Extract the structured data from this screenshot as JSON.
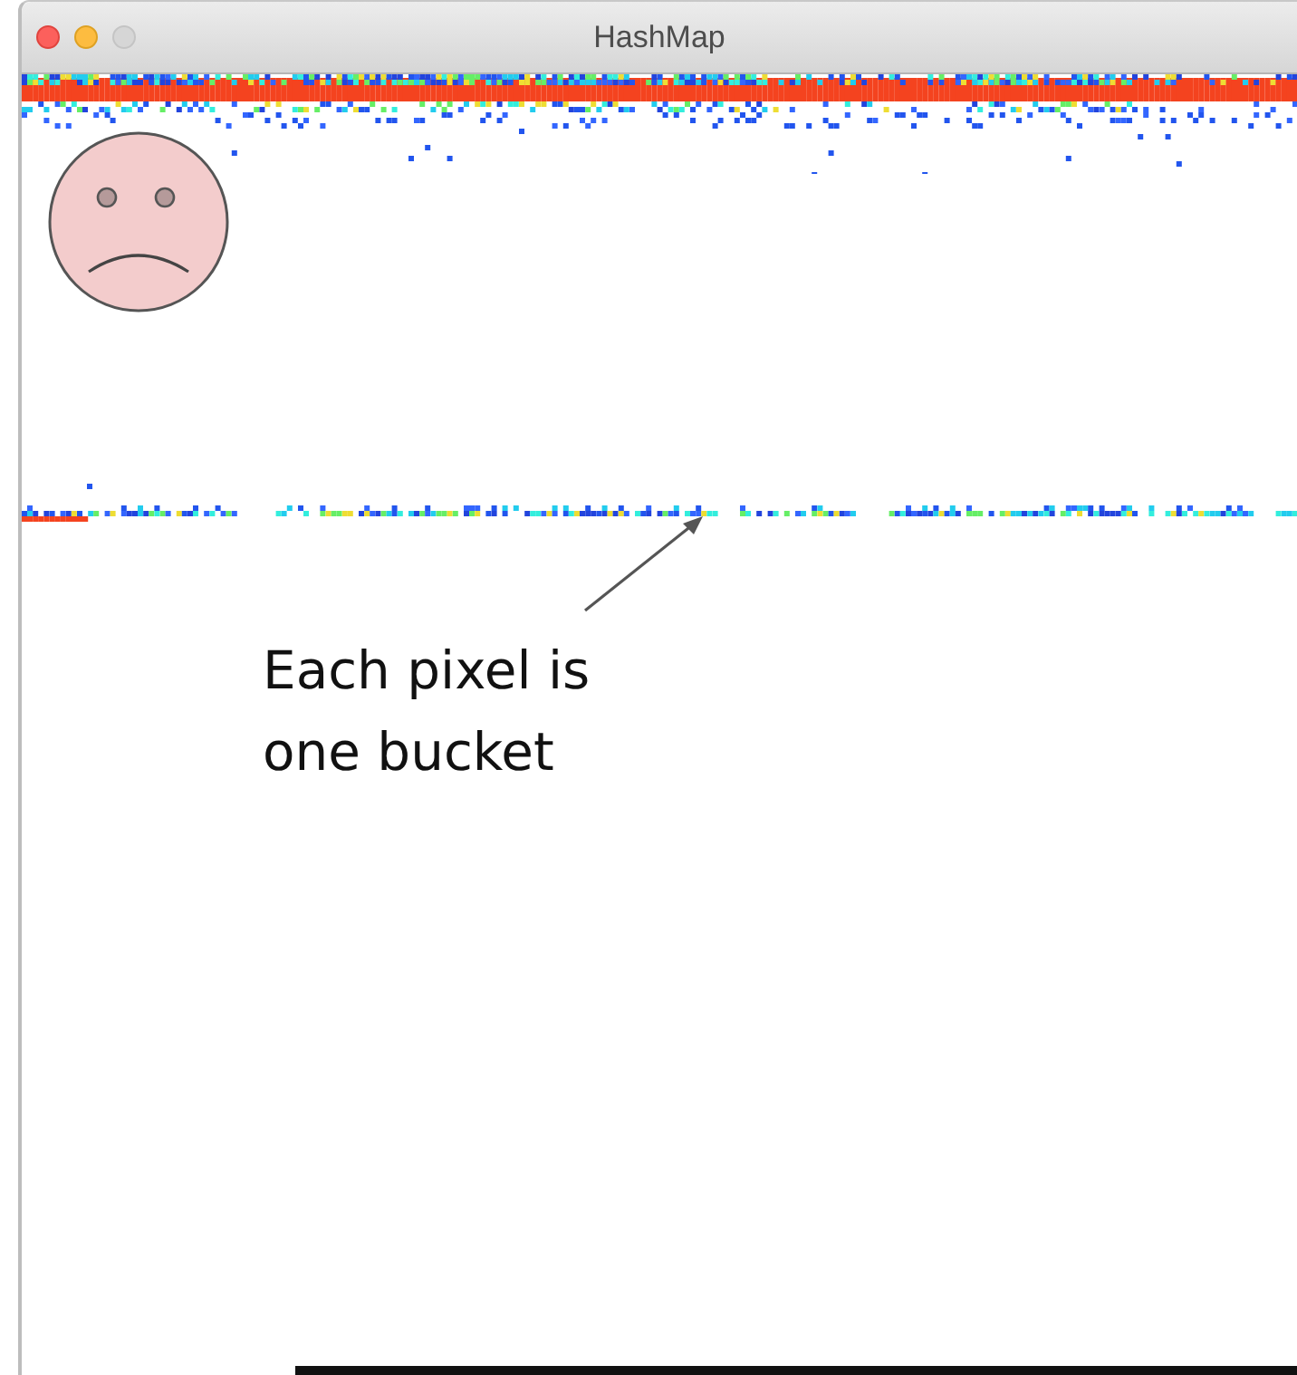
{
  "window": {
    "title": "HashMap"
  },
  "annotation": {
    "text": "Each pixel is one bucket"
  }
}
